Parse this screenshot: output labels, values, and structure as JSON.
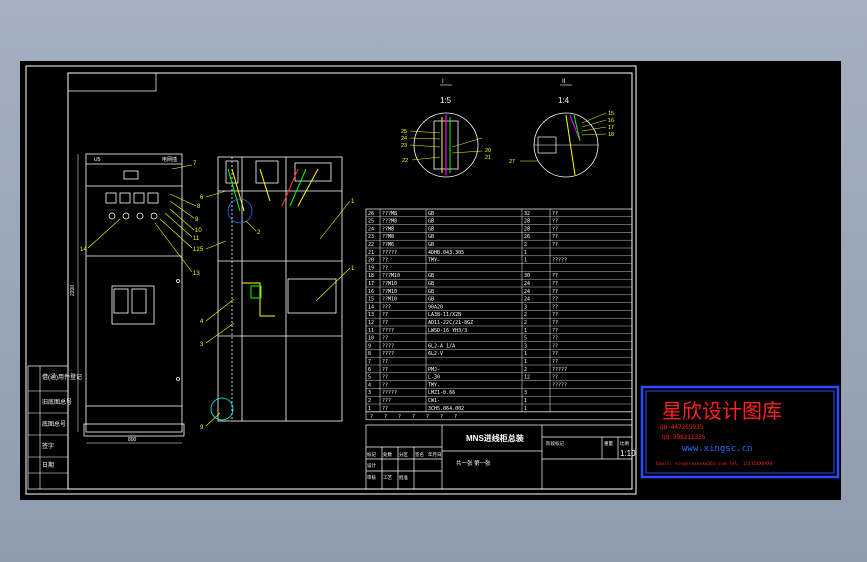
{
  "colors": {
    "background": "#9aa6b8",
    "canvas": "#000000",
    "line": "#ffffff",
    "annotation": "#ffff00",
    "wire_green": "#00ff00",
    "wire_magenta": "#ff00ff",
    "wire_red": "#ff3030",
    "watermark_border": "#2a4bff",
    "watermark_text": "#ff2020"
  },
  "front_view": {
    "header_left": "U5",
    "header_right": "电网插",
    "dimension_height": "2200",
    "dimension_width": "800",
    "callouts": [
      "7",
      "8",
      "9",
      "10",
      "11",
      "12",
      "13",
      "14"
    ]
  },
  "side_view": {
    "callouts": [
      "6",
      "5",
      "1",
      "4",
      "3",
      "1",
      "2",
      "9"
    ]
  },
  "detail_views": [
    {
      "label": "I",
      "scale": "1:5",
      "leaders": [
        "25",
        "24",
        "23",
        "22",
        "21",
        "20"
      ]
    },
    {
      "label": "II",
      "scale": "1:4",
      "leaders": [
        "15",
        "16",
        "17",
        "18",
        "27"
      ]
    }
  ],
  "parts_table": {
    "rows": [
      [
        "26",
        "???M8",
        "GB",
        "32",
        "??"
      ],
      [
        "25",
        "???M8",
        "GB",
        "28",
        "??"
      ],
      [
        "24",
        "??M8",
        "GB",
        "28",
        "??"
      ],
      [
        "23",
        "??M8",
        "GB",
        "26",
        "??"
      ],
      [
        "22",
        "??M6",
        "GB",
        "2",
        "??"
      ],
      [
        "21",
        "?????",
        "4DHB.043.305",
        "1",
        ""
      ],
      [
        "20",
        "??",
        "TMY-",
        "1",
        "?????"
      ],
      [
        "19",
        "??",
        "",
        "",
        ""
      ],
      [
        "18",
        "???M10",
        "GB",
        "30",
        "??"
      ],
      [
        "17",
        "??M10",
        "GB",
        "24",
        "??"
      ],
      [
        "16",
        "??M10",
        "GB",
        "24",
        "??"
      ],
      [
        "15",
        "??M10",
        "GB",
        "24",
        "??"
      ],
      [
        "14",
        "???",
        "90A20",
        "3",
        "??"
      ],
      [
        "13",
        "??",
        "LA38-11/X2B",
        "2",
        "??"
      ],
      [
        "12",
        "??",
        "AD11-22C/21-8GZ",
        "2",
        "??"
      ],
      [
        "11",
        "????",
        "LW5D-16 YH3/3",
        "1",
        "??"
      ],
      [
        "10",
        "??",
        "",
        "5",
        "??"
      ],
      [
        "9",
        "????",
        "6L2-A 1/A",
        "3",
        "??"
      ],
      [
        "8",
        "????",
        "6L2-V",
        "1",
        "??"
      ],
      [
        "7",
        "??",
        "",
        "1",
        "??"
      ],
      [
        "6",
        "??",
        "PMJ-",
        "2",
        "?????"
      ],
      [
        "5",
        "??",
        "L-30",
        "12",
        "??"
      ],
      [
        "4",
        "??",
        "TMY-",
        "",
        "?????"
      ],
      [
        "3",
        "?????",
        "LMZ1-0.66",
        "3",
        ""
      ],
      [
        "2",
        "???",
        "CW1-",
        "1",
        ""
      ],
      [
        "1",
        "??",
        "3CH5.064.002",
        "1",
        ""
      ]
    ],
    "header": [
      "?",
      "?",
      "?",
      "?",
      "?",
      "?",
      "?"
    ]
  },
  "title_block": {
    "drawing_title": "MNS进线柜总装",
    "scale": "1:10",
    "left_labels": [
      "标记",
      "处数",
      "分区",
      "签名",
      "年月日"
    ],
    "row_labels": [
      "设计",
      "审核",
      "工艺",
      "批准"
    ],
    "right_labels": [
      "阶段标记",
      "重量",
      "比例"
    ],
    "bottom_text": "共一张  第一张"
  },
  "side_strip": {
    "labels": [
      "借(通)用件登记",
      "旧底图总号",
      "底图总号",
      "签字",
      "日期"
    ]
  },
  "watermark": {
    "title": "星欣设计图库",
    "qq1": "QQ:447255935",
    "qq2": "QQ:398211325",
    "site": "www.xingsc.cn",
    "contact": "Email: xingscxxxxx@163.com   Tel: 15111XXXXXX"
  }
}
